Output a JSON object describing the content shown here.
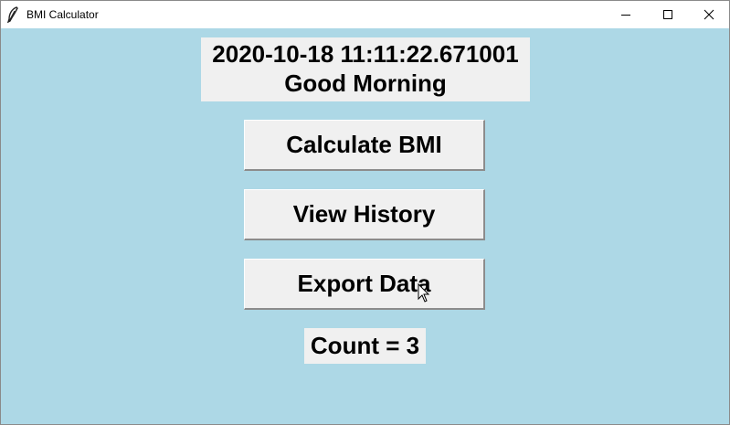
{
  "window": {
    "title": "BMI Calculator",
    "app_icon": "feather-icon",
    "controls": [
      "minimize-icon",
      "maximize-icon",
      "close-icon"
    ]
  },
  "header": {
    "datetime": "2020-10-18 11:11:22.671001",
    "greeting": "Good Morning"
  },
  "buttons": {
    "calculate": "Calculate BMI",
    "history": "View History",
    "export": "Export Data"
  },
  "counter": {
    "text": "Count = 3"
  },
  "colors": {
    "background": "#add8e6",
    "panel": "#f0f0f0",
    "text": "#000000"
  }
}
